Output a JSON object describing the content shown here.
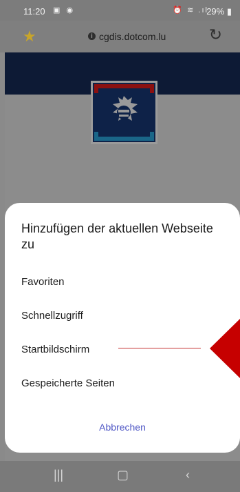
{
  "status_bar": {
    "time": "11:20",
    "battery": "29%"
  },
  "address_bar": {
    "url": "cgdis.dotcom.lu"
  },
  "sheet": {
    "title": "Hinzufügen der aktuellen Webseite zu",
    "options": [
      "Favoriten",
      "Schnellzugriff",
      "Startbildschirm",
      "Gespeicherte Seiten"
    ],
    "cancel_label": "Abbrechen"
  },
  "icons": [
    "star-icon",
    "info-icon",
    "reload-icon",
    "recent-apps-icon",
    "home-icon",
    "back-icon"
  ],
  "colors": {
    "accent": "#4f57c5",
    "annotation": "#c60000",
    "banner": "#0d1a35",
    "favorite_star": "#c8a52a"
  }
}
